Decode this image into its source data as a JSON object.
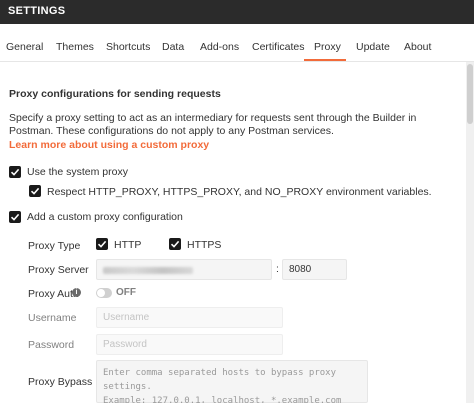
{
  "window": {
    "title": "SETTINGS"
  },
  "tabs": [
    {
      "label": "General"
    },
    {
      "label": "Themes"
    },
    {
      "label": "Shortcuts"
    },
    {
      "label": "Data"
    },
    {
      "label": "Add-ons"
    },
    {
      "label": "Certificates"
    },
    {
      "label": "Proxy",
      "active": true
    },
    {
      "label": "Update"
    },
    {
      "label": "About"
    }
  ],
  "proxy": {
    "heading": "Proxy configurations for sending requests",
    "description": "Specify a proxy setting to act as an intermediary for requests sent through the Builder in Postman. These configurations do not apply to any Postman services.",
    "learn_more": "Learn more about using a custom proxy",
    "system_proxy": {
      "label": "Use the system proxy",
      "checked": true
    },
    "respect_env": {
      "label": "Respect HTTP_PROXY, HTTPS_PROXY, and NO_PROXY environment variables.",
      "checked": true
    },
    "custom_proxy": {
      "label": "Add a custom proxy configuration",
      "checked": true
    },
    "proxy_type": {
      "label": "Proxy Type",
      "http": "HTTP",
      "https": "HTTPS",
      "http_checked": true,
      "https_checked": true
    },
    "proxy_server": {
      "label": "Proxy Server",
      "host": "",
      "separator": ":",
      "port": "8080"
    },
    "proxy_auth": {
      "label": "Proxy Auth",
      "info_icon": "i",
      "state": "OFF"
    },
    "username": {
      "label": "Username",
      "placeholder": "Username"
    },
    "password": {
      "label": "Password",
      "placeholder": "Password"
    },
    "bypass": {
      "label": "Proxy Bypass",
      "placeholder": "Enter comma separated hosts to bypass proxy settings.\nExample: 127.0.0.1, localhost, *.example.com"
    }
  },
  "colors": {
    "accent": "#f26b3a",
    "titlebar": "#2b2b2b"
  }
}
